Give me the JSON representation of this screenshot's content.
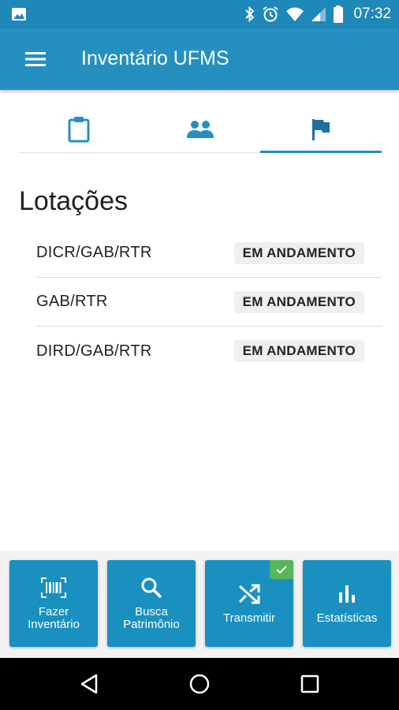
{
  "status_bar": {
    "time": "07:32",
    "icons": [
      "image-icon",
      "bluetooth-icon",
      "alarm-icon",
      "wifi-icon",
      "signal-icon",
      "battery-icon"
    ]
  },
  "app_bar": {
    "title": "Inventário UFMS",
    "menu_icon": "menu-icon"
  },
  "tabs": [
    {
      "icon": "clipboard-icon",
      "active": false
    },
    {
      "icon": "people-icon",
      "active": false
    },
    {
      "icon": "flag-icon",
      "active": true
    }
  ],
  "section": {
    "title": "Lotações"
  },
  "lotacoes": [
    {
      "name": "DICR/GAB/RTR",
      "status": "EM ANDAMENTO"
    },
    {
      "name": "GAB/RTR",
      "status": "EM ANDAMENTO"
    },
    {
      "name": "DIRD/GAB/RTR",
      "status": "EM ANDAMENTO"
    }
  ],
  "actions": [
    {
      "label": "Fazer\nInventário",
      "icon": "barcode-icon"
    },
    {
      "label": "Busca\nPatrimônio",
      "icon": "search-icon"
    },
    {
      "label": "Transmitir",
      "icon": "shuffle-icon",
      "checked": true
    },
    {
      "label": "Estatísticas",
      "icon": "bar-chart-icon"
    }
  ],
  "colors": {
    "primary": "#2590bf",
    "status_bar": "#1e88b8",
    "action_button": "#1990bf",
    "success": "#56b75a"
  },
  "nav_bar": {
    "icons": [
      "back-icon",
      "home-icon",
      "recents-icon"
    ]
  }
}
